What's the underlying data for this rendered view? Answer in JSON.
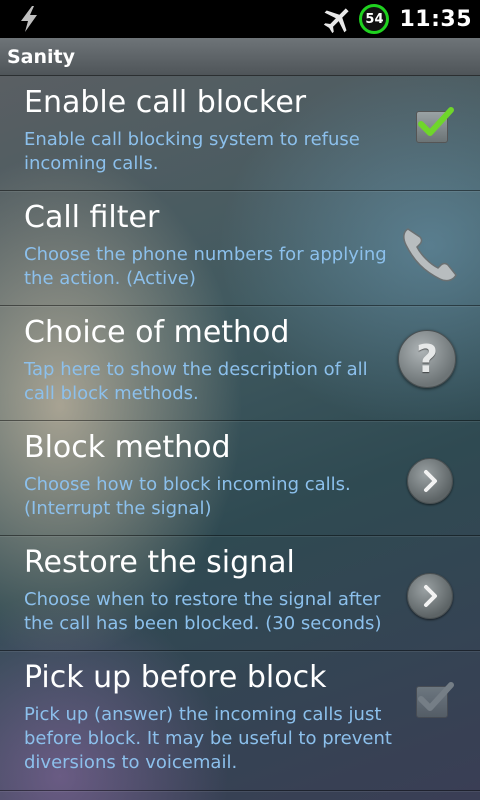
{
  "status_bar": {
    "time": "11:35",
    "battery_level": "54",
    "icons": [
      "lightning-bolt-icon",
      "airplane-icon"
    ]
  },
  "app": {
    "title": "Sanity"
  },
  "preferences": [
    {
      "title": "Enable call blocker",
      "summary": "Enable call blocking system to refuse incoming calls.",
      "widget": "checkbox",
      "checked": true,
      "enabled": true
    },
    {
      "title": "Call filter",
      "summary": "Choose the phone numbers for applying the action. (Active)",
      "widget": "phone-icon"
    },
    {
      "title": "Choice of method",
      "summary": "Tap here to show the description of all call block methods.",
      "widget": "help-icon",
      "widget_text": "?"
    },
    {
      "title": "Block method",
      "summary": "Choose how to block incoming calls. (Interrupt the signal)",
      "widget": "chevron-right-icon"
    },
    {
      "title": "Restore the signal",
      "summary": "Choose when to restore the signal after the call has been blocked. (30 seconds)",
      "widget": "chevron-right-icon"
    },
    {
      "title": "Pick up before block",
      "summary": "Pick up (answer) the incoming calls just before block. It may be useful to prevent diversions to voicemail.",
      "widget": "checkbox",
      "checked": true,
      "enabled": false
    }
  ],
  "colors": {
    "summary_text": "#8cc0ec",
    "battery_ring": "#1fd11f",
    "checkmark": "#6fd62a"
  }
}
